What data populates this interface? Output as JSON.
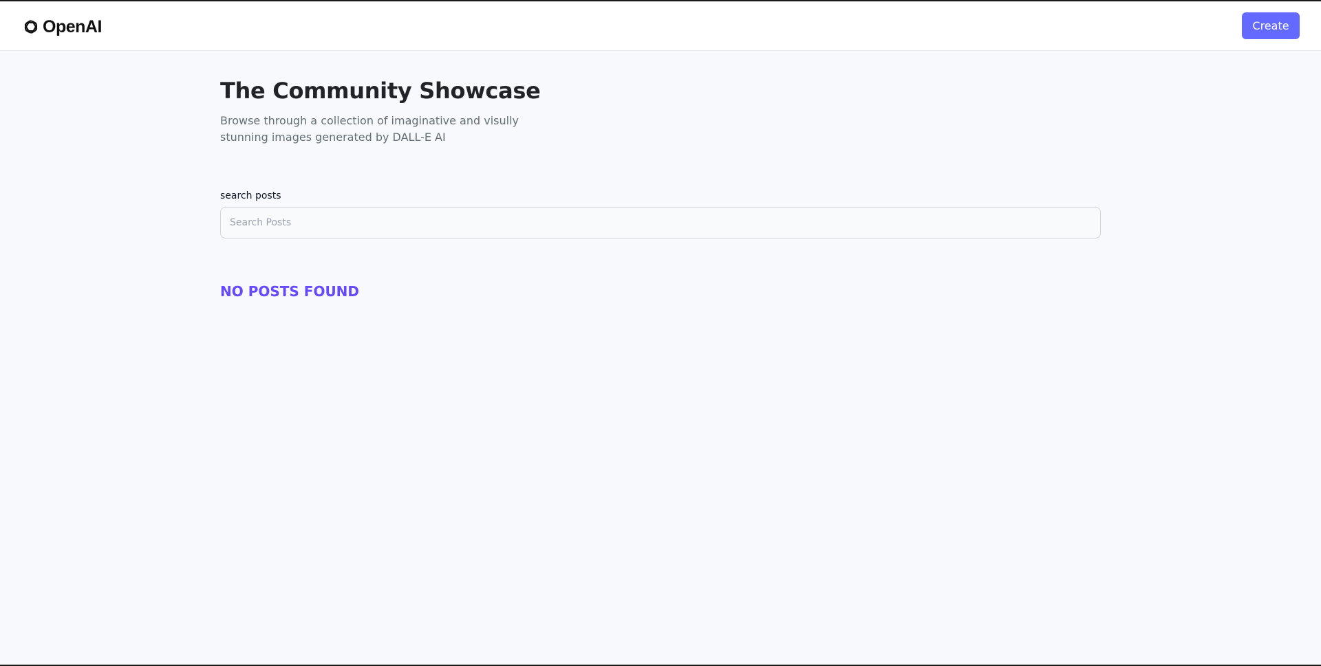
{
  "header": {
    "logo_text": "OpenAI",
    "create_label": "Create"
  },
  "main": {
    "title": "The Community Showcase",
    "subtitle": "Browse through a collection of imaginative and visully stunning images generated by DALL-E AI",
    "search": {
      "label": "search posts",
      "placeholder": "Search Posts",
      "value": ""
    },
    "empty_message": "NO POSTS FOUND"
  },
  "colors": {
    "accent": "#6469ff",
    "empty_message": "#6449ff",
    "title": "#222328",
    "subtitle": "#666e75",
    "background": "#f8f9fc"
  }
}
